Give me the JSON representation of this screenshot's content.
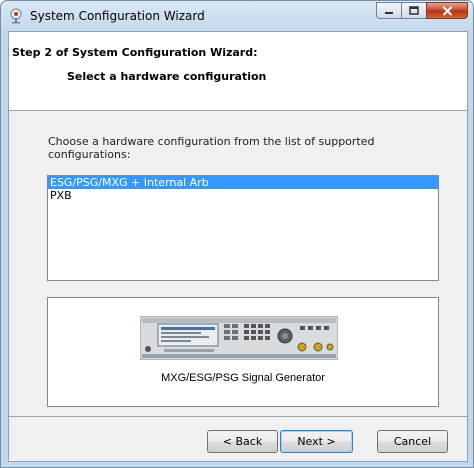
{
  "window": {
    "title": "System Configuration Wizard"
  },
  "header": {
    "step_title": "Step 2 of System Configuration Wizard:",
    "step_subtitle": "Select a hardware configuration"
  },
  "main": {
    "instruction": "Choose a hardware configuration from the list of supported configurations:",
    "configurations": [
      {
        "label": "ESG/PSG/MXG + Internal Arb",
        "selected": true
      },
      {
        "label": "PXB",
        "selected": false
      }
    ],
    "preview_caption": "MXG/ESG/PSG Signal Generator",
    "preview_image": "signal-generator-instrument"
  },
  "footer": {
    "back_label": "< Back",
    "next_label": "Next >",
    "cancel_label": "Cancel"
  },
  "colors": {
    "selection": "#3399ff",
    "close_button": "#c6452a",
    "title_gradient_top": "#dbe8f4"
  }
}
